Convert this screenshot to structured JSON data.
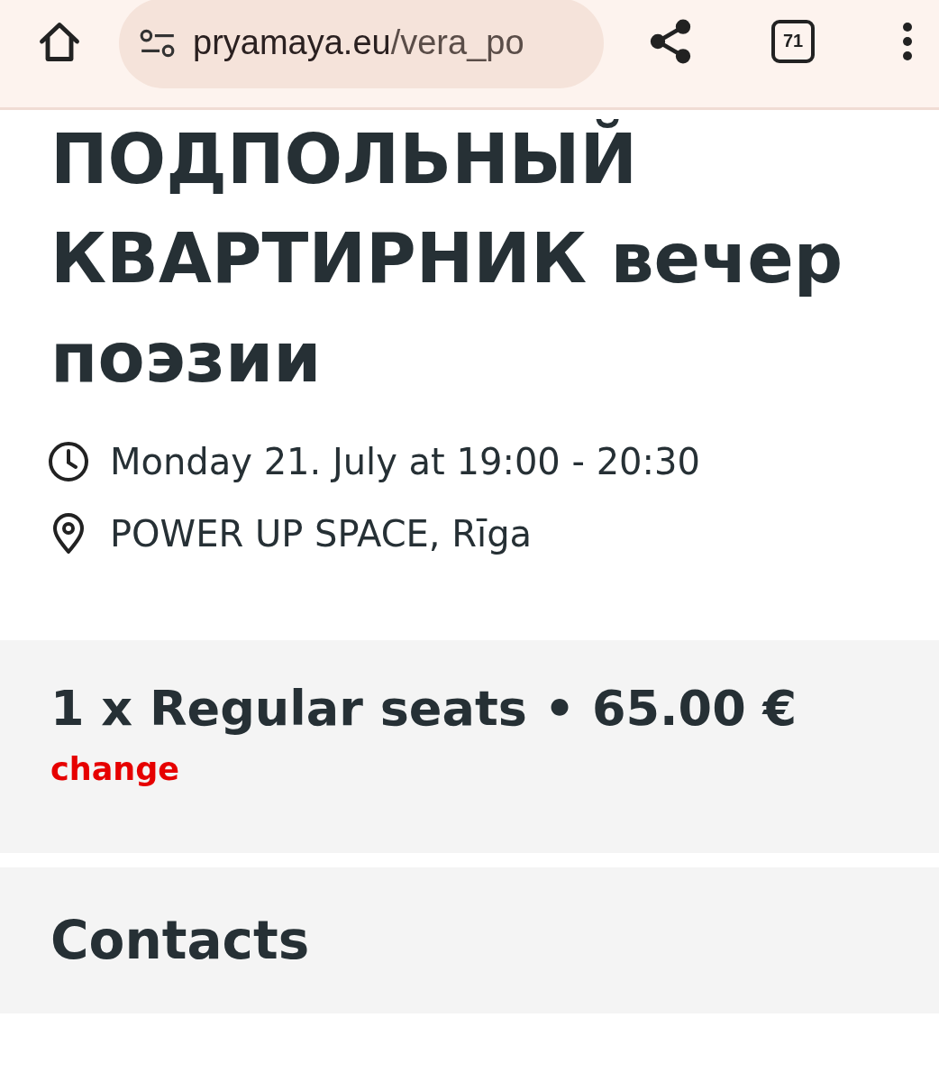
{
  "toolbar": {
    "url_domain": "pryamaya.eu",
    "url_path": "/vera_po",
    "tab_count": "71"
  },
  "event": {
    "title": "ПОДПОЛЬНЫЙ КВАРТИРНИК вечер поэзии",
    "datetime": "Monday 21. July at 19:00 - 20:30",
    "location": "POWER UP SPACE, Rīga"
  },
  "ticket": {
    "summary": "1 x Regular seats • 65.00 €",
    "change_link": "change"
  },
  "contacts": {
    "heading": "Contacts"
  }
}
